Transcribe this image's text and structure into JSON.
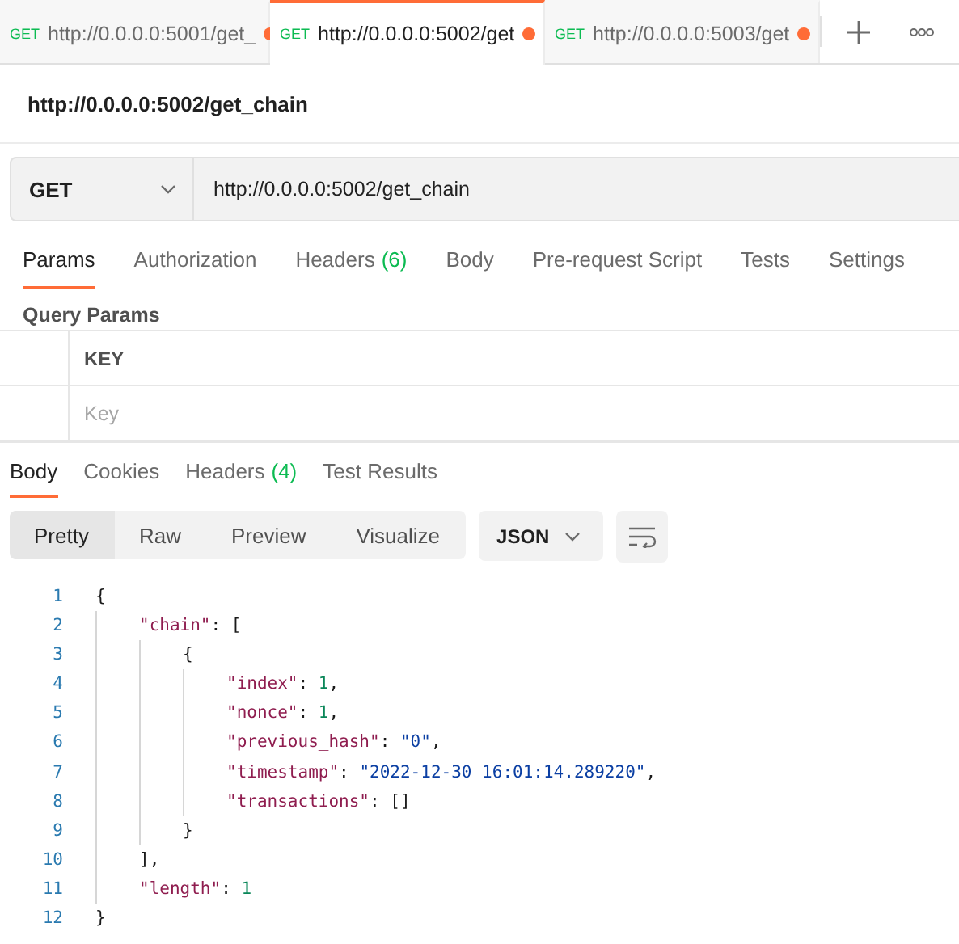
{
  "tabs": [
    {
      "method": "GET",
      "url": "http://0.0.0.0:5001/get_",
      "unsaved": true,
      "selected": false
    },
    {
      "method": "GET",
      "url": "http://0.0.0.0:5002/get",
      "unsaved": true,
      "selected": true
    },
    {
      "method": "GET",
      "url": "http://0.0.0.0:5003/get",
      "unsaved": true,
      "selected": false
    }
  ],
  "request_title": "http://0.0.0.0:5002/get_chain",
  "request": {
    "method": "GET",
    "url": "http://0.0.0.0:5002/get_chain"
  },
  "request_tabs": [
    {
      "label": "Params",
      "selected": true
    },
    {
      "label": "Authorization",
      "selected": false
    },
    {
      "label": "Headers",
      "count": "(6)",
      "selected": false
    },
    {
      "label": "Body",
      "selected": false
    },
    {
      "label": "Pre-request Script",
      "selected": false
    },
    {
      "label": "Tests",
      "selected": false
    },
    {
      "label": "Settings",
      "selected": false
    }
  ],
  "query_params": {
    "title": "Query Params",
    "column": "KEY",
    "placeholder": "Key"
  },
  "response_tabs": [
    {
      "label": "Body",
      "selected": true
    },
    {
      "label": "Cookies",
      "selected": false
    },
    {
      "label": "Headers",
      "count": "(4)",
      "selected": false
    },
    {
      "label": "Test Results",
      "selected": false
    }
  ],
  "view_modes": [
    {
      "label": "Pretty",
      "selected": true
    },
    {
      "label": "Raw",
      "selected": false
    },
    {
      "label": "Preview",
      "selected": false
    },
    {
      "label": "Visualize",
      "selected": false
    }
  ],
  "format": "JSON",
  "code": [
    {
      "number": "1",
      "tokens": [
        {
          "kind": "punct",
          "text": "{"
        }
      ],
      "children": [
        {
          "number": "2",
          "tokens": [
            {
              "kind": "key",
              "text": "\"chain\""
            },
            {
              "kind": "punct",
              "text": ": ["
            }
          ],
          "children": [
            {
              "number": "3",
              "tokens": [
                {
                  "kind": "punct",
                  "text": "{"
                }
              ],
              "children": [
                {
                  "number": "4",
                  "tokens": [
                    {
                      "kind": "key",
                      "text": "\"index\""
                    },
                    {
                      "kind": "punct",
                      "text": ": "
                    },
                    {
                      "kind": "number",
                      "text": "1"
                    },
                    {
                      "kind": "punct",
                      "text": ","
                    }
                  ]
                },
                {
                  "number": "5",
                  "tokens": [
                    {
                      "kind": "key",
                      "text": "\"nonce\""
                    },
                    {
                      "kind": "punct",
                      "text": ": "
                    },
                    {
                      "kind": "number",
                      "text": "1"
                    },
                    {
                      "kind": "punct",
                      "text": ","
                    }
                  ]
                },
                {
                  "number": "6",
                  "tokens": [
                    {
                      "kind": "key",
                      "text": "\"previous_hash\""
                    },
                    {
                      "kind": "punct",
                      "text": ": "
                    },
                    {
                      "kind": "string",
                      "text": "\"0\""
                    },
                    {
                      "kind": "punct",
                      "text": ","
                    }
                  ]
                },
                {
                  "number": "7",
                  "tokens": [
                    {
                      "kind": "key",
                      "text": "\"timestamp\""
                    },
                    {
                      "kind": "punct",
                      "text": ": "
                    },
                    {
                      "kind": "string",
                      "text": "\"2022-12-30 16:01:14.289220\""
                    },
                    {
                      "kind": "punct",
                      "text": ","
                    }
                  ]
                },
                {
                  "number": "8",
                  "tokens": [
                    {
                      "kind": "key",
                      "text": "\"transactions\""
                    },
                    {
                      "kind": "punct",
                      "text": ": []"
                    }
                  ]
                }
              ]
            },
            {
              "number": "9",
              "tokens": [
                {
                  "kind": "punct",
                  "text": "}"
                }
              ]
            }
          ]
        },
        {
          "number": "10",
          "tokens": [
            {
              "kind": "punct",
              "text": "],"
            }
          ]
        },
        {
          "number": "11",
          "tokens": [
            {
              "kind": "key",
              "text": "\"length\""
            },
            {
              "kind": "punct",
              "text": ": "
            },
            {
              "kind": "number",
              "text": "1"
            }
          ]
        }
      ]
    },
    {
      "number": "12",
      "tokens": [
        {
          "kind": "punct",
          "text": "}"
        }
      ]
    }
  ]
}
